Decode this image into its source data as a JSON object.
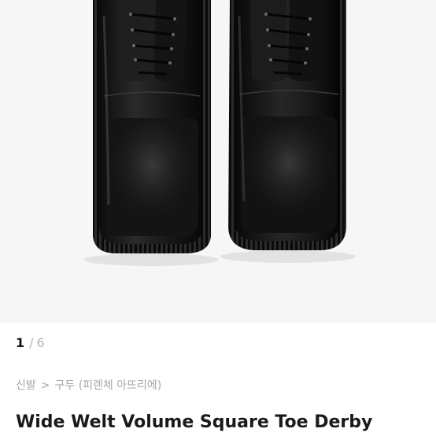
{
  "image_counter": {
    "current": "1",
    "separator": "/",
    "total": "6"
  },
  "breadcrumb": {
    "category": "신발",
    "separator": ">",
    "subcategory": "구두 (피렌체 아뜨리에)"
  },
  "product": {
    "title": "Wide Welt Volume Square Toe Derby"
  },
  "colors": {
    "photo_background": "#f6f6f7",
    "counter_active": "#111111",
    "counter_muted": "#b3b3b3",
    "breadcrumb_text": "#a6a6a6",
    "title_text": "#1a1a1a"
  }
}
